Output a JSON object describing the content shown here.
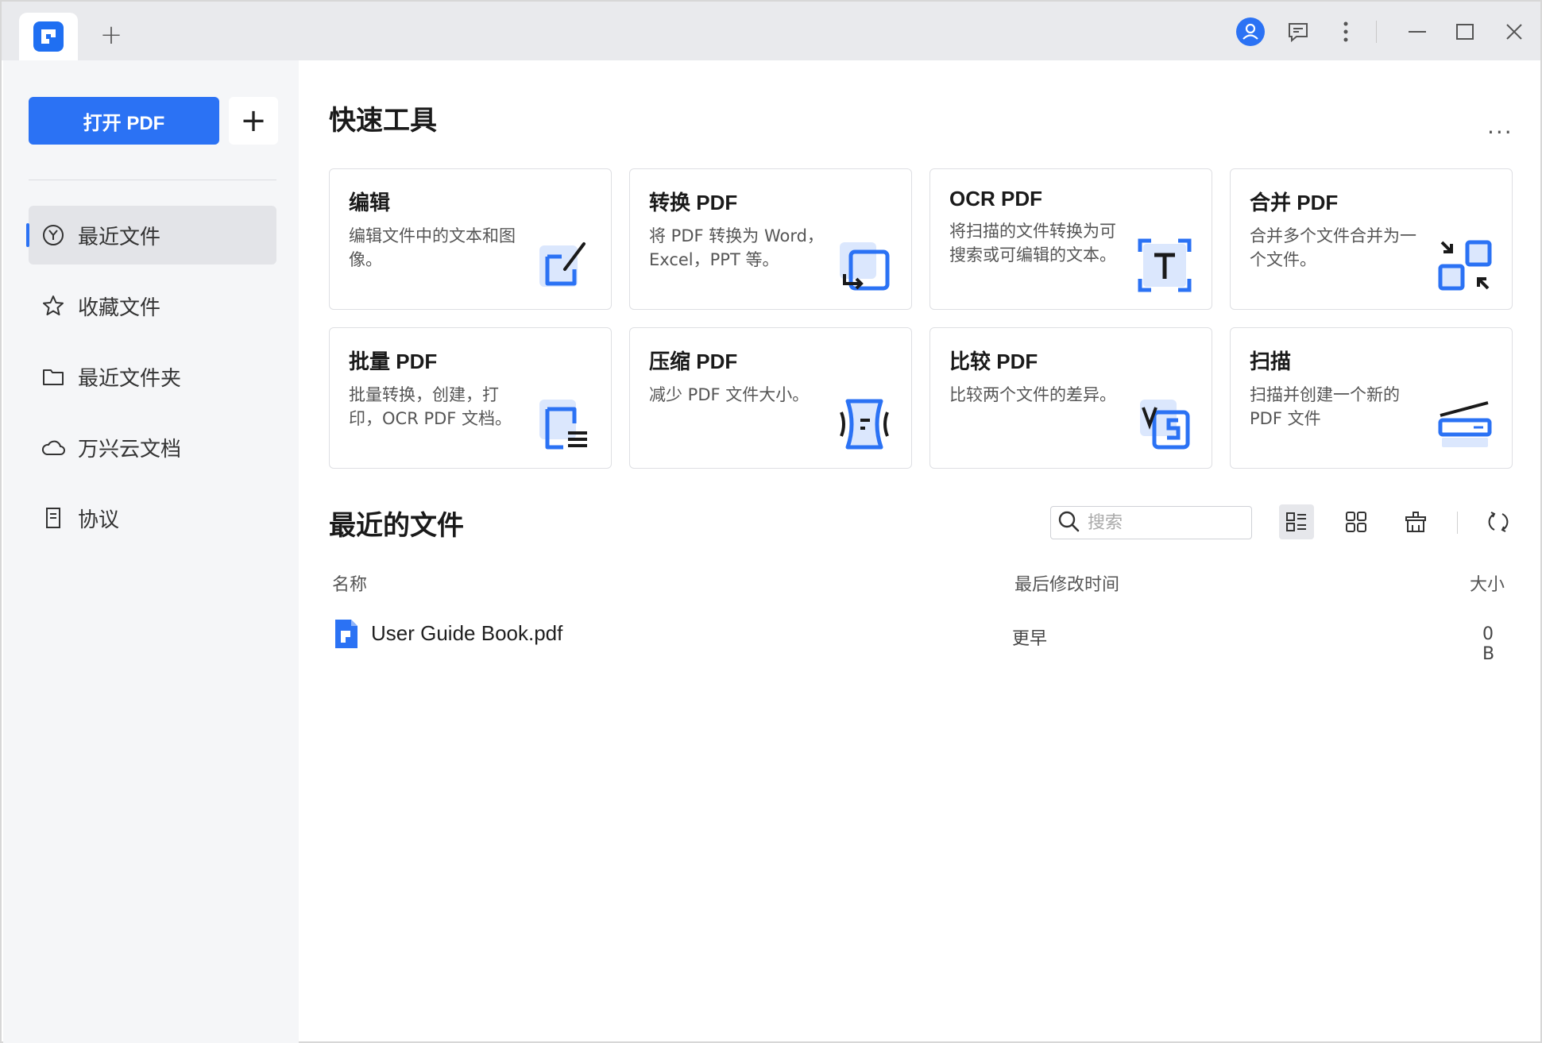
{
  "titlebar": {
    "new_tab_symbol": "+"
  },
  "sidebar": {
    "open_button": "打开 PDF",
    "add_button": "+",
    "items": [
      {
        "label": "最近文件",
        "icon": "clock-icon",
        "active": true
      },
      {
        "label": "收藏文件",
        "icon": "star-icon",
        "active": false
      },
      {
        "label": "最近文件夹",
        "icon": "folder-icon",
        "active": false
      },
      {
        "label": "万兴云文档",
        "icon": "cloud-icon",
        "active": false
      },
      {
        "label": "协议",
        "icon": "document-icon",
        "active": false
      }
    ]
  },
  "quick_tools": {
    "title": "快速工具",
    "more": "...",
    "cards": [
      {
        "title": "编辑",
        "desc": "编辑文件中的文本和图像。",
        "icon": "edit-icon"
      },
      {
        "title": "转换 PDF",
        "desc": "将 PDF 转换为 Word， Excel，PPT 等。",
        "icon": "convert-icon"
      },
      {
        "title": "OCR PDF",
        "desc": "将扫描的文件转换为可搜索或可编辑的文本。",
        "icon": "ocr-icon"
      },
      {
        "title": "合并 PDF",
        "desc": "合并多个文件合并为一个文件。",
        "icon": "merge-icon"
      },
      {
        "title": "批量 PDF",
        "desc": "批量转换，创建，打印，OCR PDF 文档。",
        "icon": "batch-icon"
      },
      {
        "title": "压缩 PDF",
        "desc": "减少 PDF 文件大小。",
        "icon": "compress-icon"
      },
      {
        "title": "比较 PDF",
        "desc": "比较两个文件的差异。",
        "icon": "compare-icon"
      },
      {
        "title": "扫描",
        "desc": "扫描并创建一个新的 PDF 文件",
        "icon": "scan-icon"
      }
    ]
  },
  "recent_files": {
    "title": "最近的文件",
    "search_placeholder": "搜索",
    "columns": {
      "name": "名称",
      "modified": "最后修改时间",
      "size": "大小"
    },
    "rows": [
      {
        "name": "User Guide Book.pdf",
        "modified": "更早",
        "size": "0 B"
      }
    ]
  },
  "colors": {
    "accent": "#2b72f4",
    "sidebar_bg": "#f5f6f8",
    "titlebar_bg": "#e9eaed"
  }
}
